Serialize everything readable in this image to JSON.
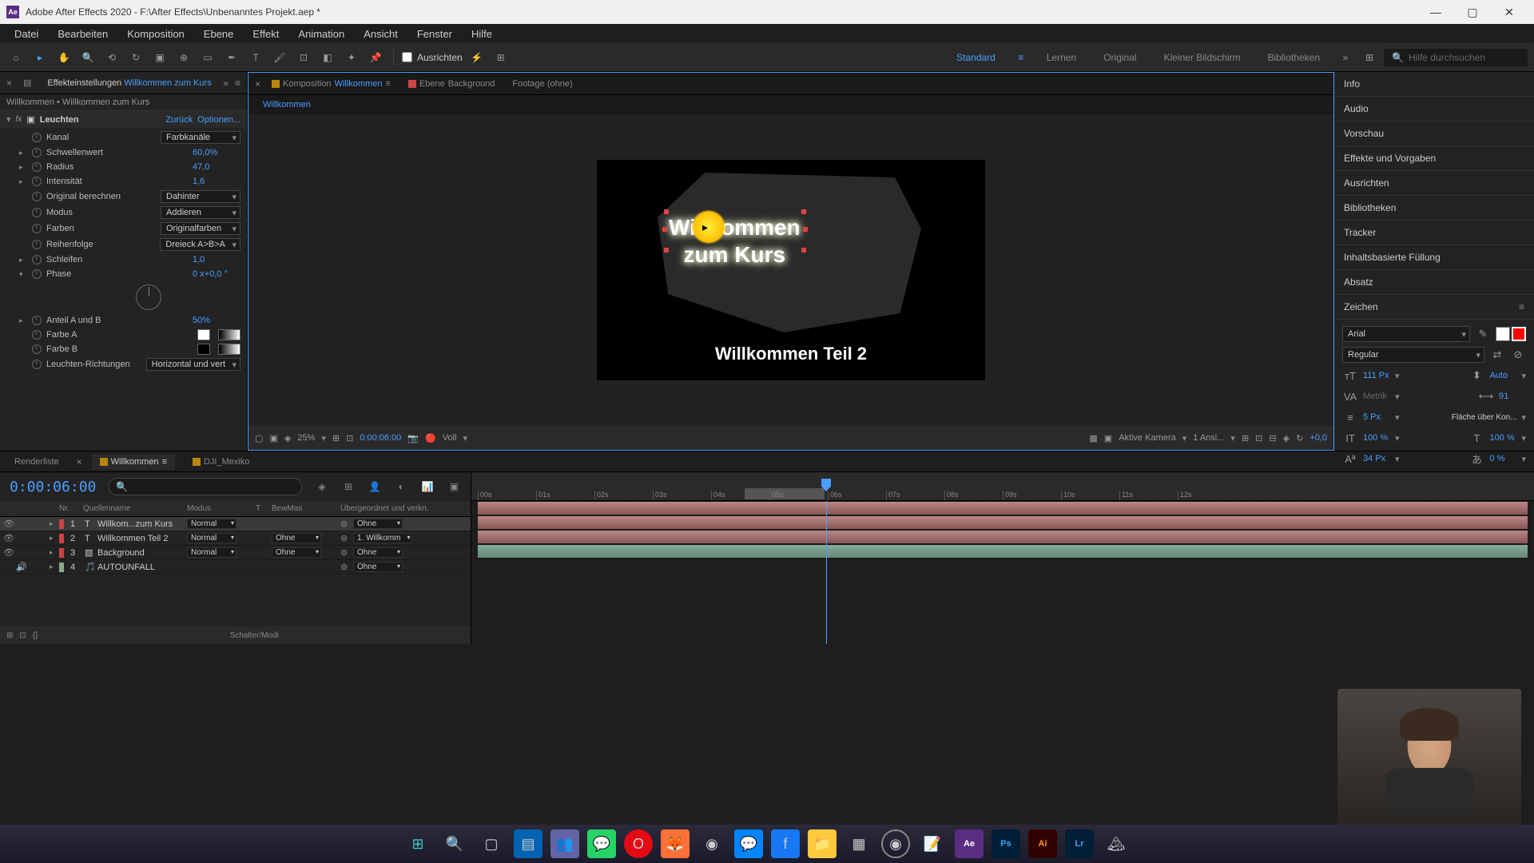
{
  "titlebar": {
    "app_icon": "Ae",
    "title": "Adobe After Effects 2020 - F:\\After Effects\\Unbenanntes Projekt.aep *"
  },
  "menubar": [
    "Datei",
    "Bearbeiten",
    "Komposition",
    "Ebene",
    "Effekt",
    "Animation",
    "Ansicht",
    "Fenster",
    "Hilfe"
  ],
  "toolbar": {
    "align_label": "Ausrichten",
    "workspaces": [
      "Standard",
      "Lernen",
      "Original",
      "Kleiner Bildschirm",
      "Bibliotheken"
    ],
    "search_placeholder": "Hilfe durchsuchen"
  },
  "effects": {
    "tabs": {
      "effekt_label": "Effekteinstellungen",
      "effekt_target": "Willkommen zum Kurs"
    },
    "breadcrumb": "Willkommen • Willkommen zum Kurs",
    "effect_name": "Leuchten",
    "link_zuruck": "Zurück",
    "link_optionen": "Optionen...",
    "props": {
      "kanal": {
        "label": "Kanal",
        "value": "Farbkanäle"
      },
      "schwellenwert": {
        "label": "Schwellenwert",
        "value": "60,0%"
      },
      "radius": {
        "label": "Radius",
        "value": "47,0"
      },
      "intensitat": {
        "label": "Intensität",
        "value": "1,6"
      },
      "original": {
        "label": "Original berechnen",
        "value": "Dahinter"
      },
      "modus": {
        "label": "Modus",
        "value": "Addieren"
      },
      "farben": {
        "label": "Farben",
        "value": "Originalfarben"
      },
      "reihenfolge": {
        "label": "Reihenfolge",
        "value": "Dreieck A>B>A"
      },
      "schleifen": {
        "label": "Schleifen",
        "value": "1,0"
      },
      "phase": {
        "label": "Phase",
        "value": "0 x+0,0 °"
      },
      "anteil": {
        "label": "Anteil A und B",
        "value": "50%"
      },
      "farbea": {
        "label": "Farbe A"
      },
      "farbeb": {
        "label": "Farbe B"
      },
      "richtungen": {
        "label": "Leuchten-Richtungen",
        "value": "Horizontal und vert"
      }
    }
  },
  "comp": {
    "tab_komp_label": "Komposition",
    "tab_komp_target": "Willkommen",
    "tab_ebene_label": "Ebene",
    "tab_ebene_target": "Background",
    "tab_footage": "Footage (ohne)",
    "breadcrumb": "Willkommen",
    "text1_line1": "Willkommen",
    "text1_line2": "zum Kurs",
    "text2": "Willkommen Teil 2",
    "controls": {
      "zoom": "25%",
      "timecode": "0:00:06:00",
      "res": "Voll",
      "camera": "Aktive Kamera",
      "views": "1 Ansi...",
      "exposure": "+0,0"
    }
  },
  "right_panels": [
    "Info",
    "Audio",
    "Vorschau",
    "Effekte und Vorgaben",
    "Ausrichten",
    "Bibliotheken",
    "Tracker",
    "Inhaltsbasierte Füllung",
    "Absatz"
  ],
  "zeichen": {
    "title": "Zeichen",
    "font": "Arial",
    "style": "Regular",
    "size": "111 Px",
    "leading": "Auto",
    "kerning": "Metrik",
    "tracking": "91",
    "stroke": "5 Px",
    "fillopt": "Fläche über Kon...",
    "vscale": "100 %",
    "hscale": "100 %",
    "baseline": "34 Px",
    "tsume": "0 %"
  },
  "timeline": {
    "tabs": {
      "render": "Renderliste",
      "comp": "Willkommen",
      "dji": "DJI_Mexiko"
    },
    "timecode": "0:00:06:00",
    "headers": {
      "nr": "Nr.",
      "name": "Quellenname",
      "modus": "Modus",
      "t": "T",
      "bewmas": "BewMas",
      "parent": "Übergeordnet und verkn."
    },
    "layers": [
      {
        "num": "1",
        "name": "Willkom...zum Kurs",
        "type": "T",
        "mode": "Normal",
        "trkmat": "",
        "parent": "Ohne",
        "color": "#c44",
        "sel": true
      },
      {
        "num": "2",
        "name": "Willkommen Teil 2",
        "type": "T",
        "mode": "Normal",
        "trkmat": "Ohne",
        "parent": "1. Willkomm",
        "color": "#c44",
        "sel": false
      },
      {
        "num": "3",
        "name": "Background",
        "type": "S",
        "mode": "Normal",
        "trkmat": "Ohne",
        "parent": "Ohne",
        "color": "#c44",
        "sel": false
      },
      {
        "num": "4",
        "name": "AUTOUNFALL",
        "type": "A",
        "mode": "",
        "trkmat": "",
        "parent": "Ohne",
        "color": "#8a8",
        "sel": false
      }
    ],
    "ruler": [
      "00s",
      "01s",
      "02s",
      "03s",
      "04s",
      "05s",
      "06s",
      "07s",
      "08s",
      "09s",
      "10s",
      "11s",
      "12s"
    ],
    "footer": "Schalter/Modi"
  }
}
